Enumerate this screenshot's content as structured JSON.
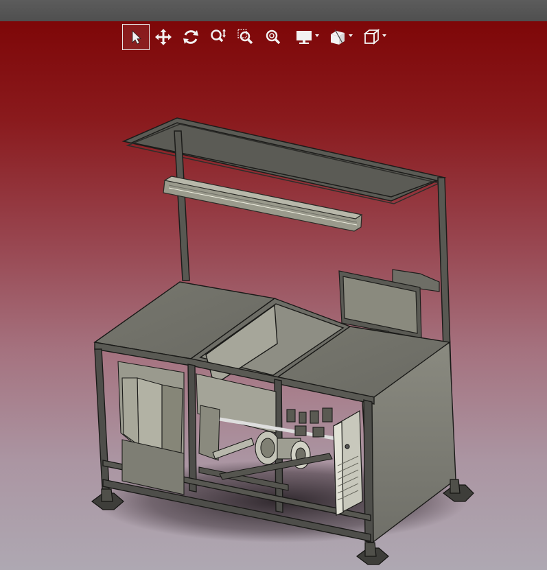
{
  "app": {
    "accent_bg_top": "#7e0708",
    "accent_bg_bottom": "#aea8b2",
    "toolbar_icon_color": "#f2f2f2"
  },
  "toolbar": {
    "tools": [
      {
        "icon": "select-arrow-icon",
        "active": true
      },
      {
        "icon": "pan-move-icon",
        "active": false
      },
      {
        "icon": "rotate-icon",
        "active": false
      },
      {
        "icon": "zoom-in-out-icon",
        "active": false
      },
      {
        "icon": "zoom-area-icon",
        "active": false
      },
      {
        "icon": "zoom-fit-icon",
        "active": false
      },
      {
        "icon": "display-mode-icon",
        "active": false,
        "dropdown": true
      },
      {
        "icon": "section-view-icon",
        "active": false,
        "dropdown": true
      },
      {
        "icon": "view-cube-icon",
        "active": false,
        "dropdown": true
      }
    ]
  },
  "model": {
    "description_icon": "workbench-3d-model",
    "render_style": "shaded-with-edges"
  }
}
